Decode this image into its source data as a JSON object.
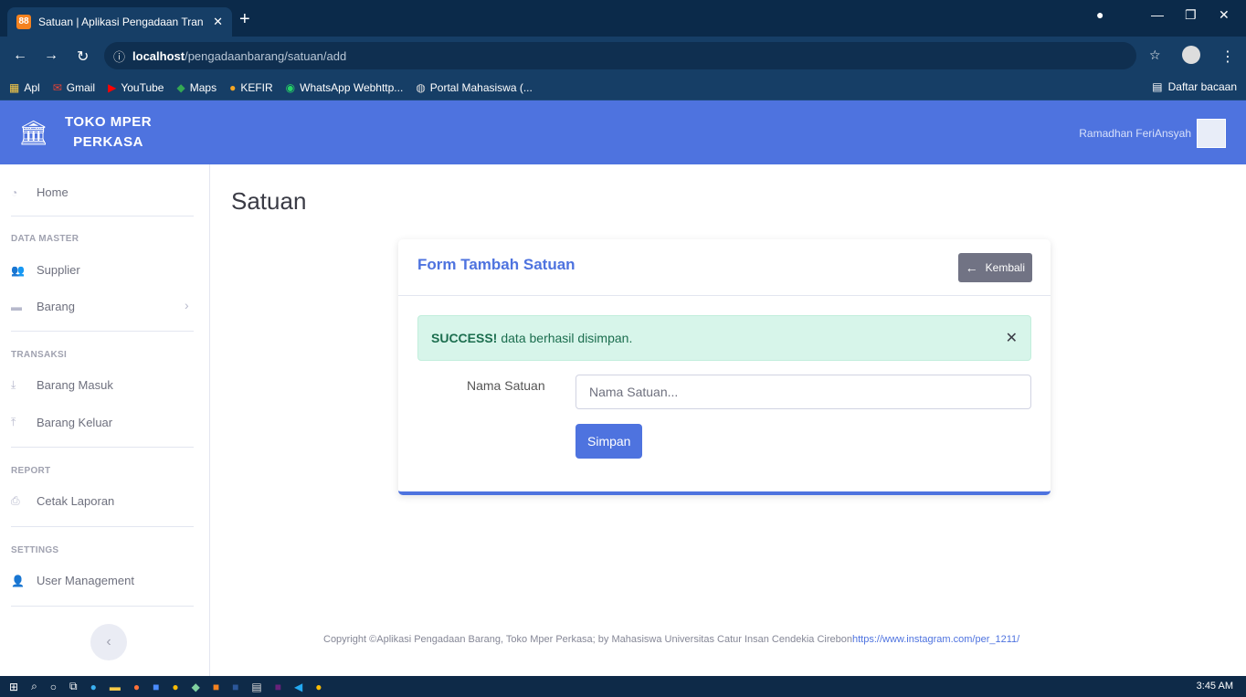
{
  "browser": {
    "tab_title": "Satuan | Aplikasi Pengadaan Tran",
    "tab_icon_text": "88",
    "url_host": "localhost",
    "url_path": "/pengadaanbarang/satuan/add",
    "bookmarks": [
      {
        "label": "Apl",
        "icon": "apps-grid-icon"
      },
      {
        "label": "Gmail",
        "icon": "gmail-icon"
      },
      {
        "label": "YouTube",
        "icon": "youtube-icon"
      },
      {
        "label": "Maps",
        "icon": "maps-icon"
      },
      {
        "label": "KEFIR",
        "icon": "kefir-icon"
      },
      {
        "label": "WhatsApp Webhttp...",
        "icon": "whatsapp-icon"
      },
      {
        "label": "Portal Mahasiswa (...",
        "icon": "globe-icon"
      }
    ],
    "reading_list": "Daftar bacaan"
  },
  "app": {
    "brand_line1": "TOKO MPER",
    "brand_line2": "PERKASA",
    "user_name": "Ramadhan FeriAnsyah"
  },
  "sidebar": {
    "home": "Home",
    "sections": [
      {
        "heading": "DATA MASTER",
        "items": [
          "Supplier",
          "Barang"
        ]
      },
      {
        "heading": "TRANSAKSI",
        "items": [
          "Barang Masuk",
          "Barang Keluar"
        ]
      },
      {
        "heading": "REPORT",
        "items": [
          "Cetak Laporan"
        ]
      },
      {
        "heading": "SETTINGS",
        "items": [
          "User Management"
        ]
      }
    ]
  },
  "main": {
    "page_title": "Satuan",
    "card_title": "Form Tambah Satuan",
    "back_label": "Kembali",
    "alert_strong": "SUCCESS!",
    "alert_text": "data berhasil disimpan.",
    "field_label": "Nama Satuan",
    "field_placeholder": "Nama Satuan...",
    "save_label": "Simpan"
  },
  "footer": {
    "text": "Copyright ©Aplikasi Pengadaan Barang, Toko Mper Perkasa; by Mahasiswa Universitas Catur Insan Cendekia Cirebon",
    "link": "https://www.instagram.com/per_1211/"
  },
  "taskbar": {
    "time": "3:45 AM"
  },
  "colors": {
    "primary": "#4e73df",
    "success_bg": "#d7f5ea",
    "browser_dark": "#0b2a4a"
  }
}
